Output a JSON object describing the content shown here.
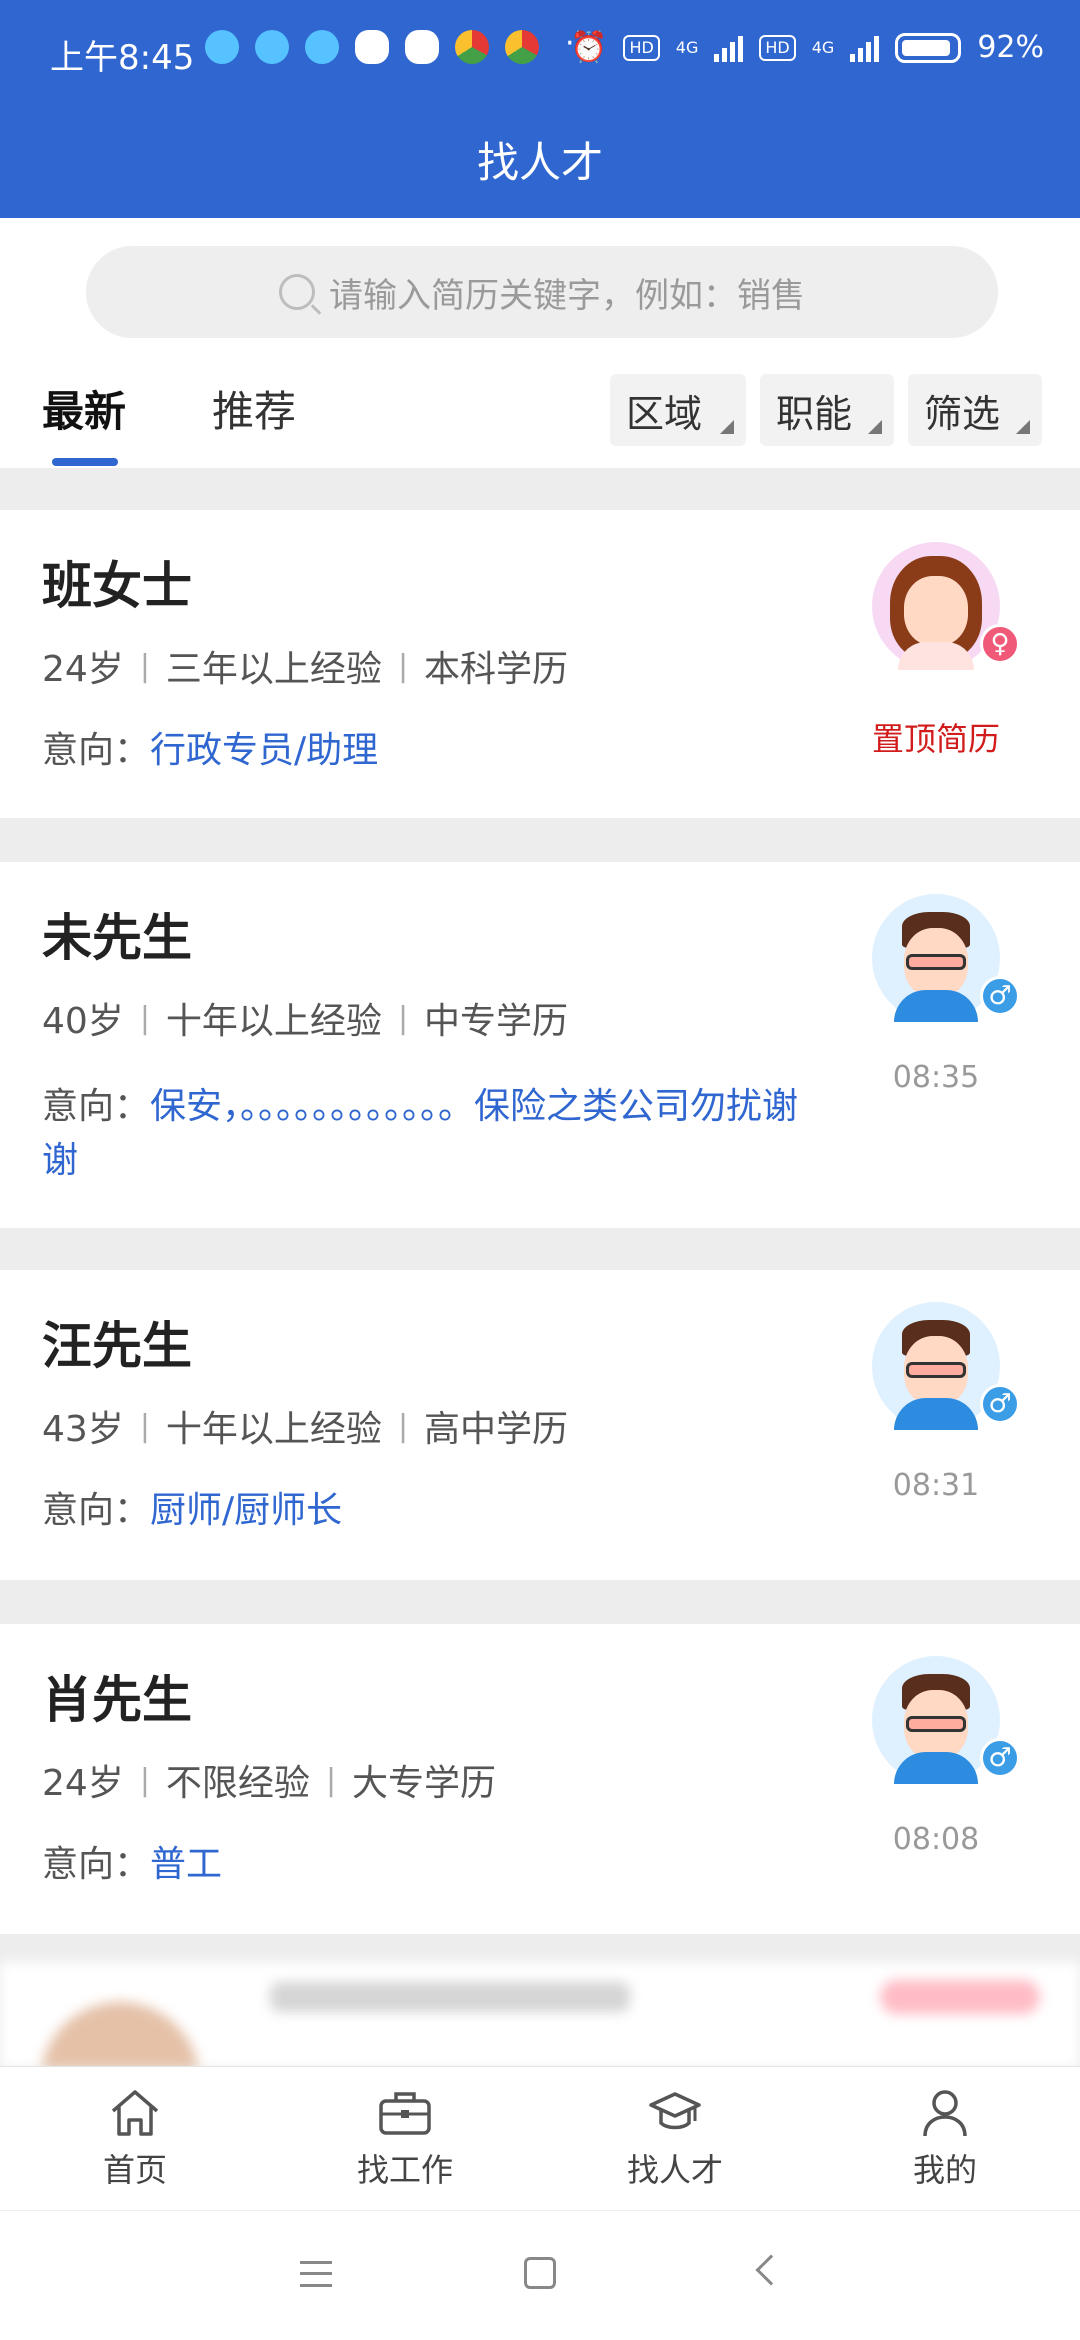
{
  "status_bar": {
    "time": "上午8:45",
    "battery": "92%",
    "hd1": "HD",
    "hd2": "HD",
    "net1": "4G",
    "net2": "4G",
    "more": "···"
  },
  "header": {
    "title": "找人才"
  },
  "search": {
    "placeholder": "请输入简历关键字，例如：销售"
  },
  "tabs": [
    {
      "label": "最新",
      "active": true
    },
    {
      "label": "推荐",
      "active": false
    }
  ],
  "filters": [
    {
      "label": "区域"
    },
    {
      "label": "职能"
    },
    {
      "label": "筛选"
    }
  ],
  "intent_label": "意向：",
  "candidates": [
    {
      "name": "班女士",
      "age": "24岁",
      "experience": "三年以上经验",
      "education": "本科学历",
      "intent": "行政专员/助理",
      "gender": "female",
      "side_text": "置顶简历"
    },
    {
      "name": "未先生",
      "age": "40岁",
      "experience": "十年以上经验",
      "education": "中专学历",
      "intent": "保安，。。。。。。。。。。。。保险之类公司勿扰谢谢",
      "gender": "male",
      "side_text": "08:35"
    },
    {
      "name": "汪先生",
      "age": "43岁",
      "experience": "十年以上经验",
      "education": "高中学历",
      "intent": "厨师/厨师长",
      "gender": "male",
      "side_text": "08:31"
    },
    {
      "name": "肖先生",
      "age": "24岁",
      "experience": "不限经验",
      "education": "大专学历",
      "intent": "普工",
      "gender": "male",
      "side_text": "08:08"
    }
  ],
  "gender_symbols": {
    "male": "♂",
    "female": "♀"
  },
  "separator": "|",
  "bottom_nav": [
    {
      "label": "首页",
      "icon": "home-icon"
    },
    {
      "label": "找工作",
      "icon": "briefcase-icon"
    },
    {
      "label": "找人才",
      "icon": "graduation-cap-icon"
    },
    {
      "label": "我的",
      "icon": "user-icon"
    }
  ]
}
